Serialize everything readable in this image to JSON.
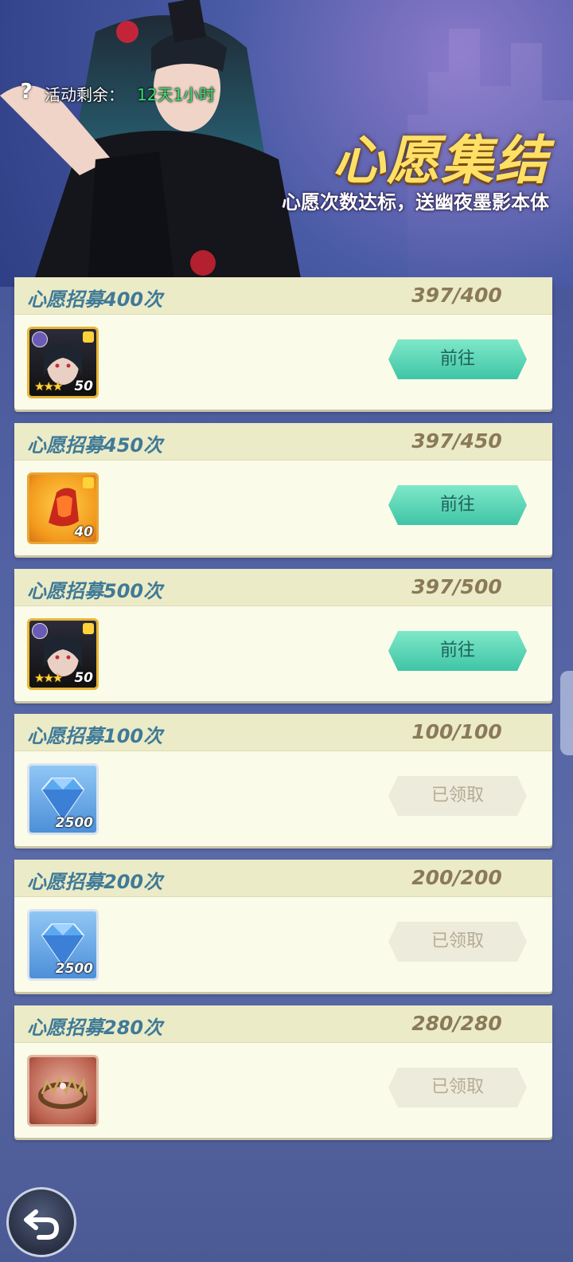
{
  "header": {
    "timer_label": "活动剩余：",
    "timer_value": "12天1小时",
    "title": "心愿集结",
    "subtitle": "心愿次数达标，送幽夜墨影本体"
  },
  "tasks": [
    {
      "title": "心愿招募400次",
      "progress": "397/400",
      "item_count": "50",
      "item_kind": "hero-shard",
      "button": "前往",
      "state": "go"
    },
    {
      "title": "心愿招募450次",
      "progress": "397/450",
      "item_count": "40",
      "item_kind": "red-artifact-shard",
      "button": "前往",
      "state": "go"
    },
    {
      "title": "心愿招募500次",
      "progress": "397/500",
      "item_count": "50",
      "item_kind": "hero-shard",
      "button": "前往",
      "state": "go"
    },
    {
      "title": "心愿招募100次",
      "progress": "100/100",
      "item_count": "2500",
      "item_kind": "diamond",
      "button": "已领取",
      "state": "claimed"
    },
    {
      "title": "心愿招募200次",
      "progress": "200/200",
      "item_count": "2500",
      "item_kind": "diamond",
      "button": "已领取",
      "state": "claimed"
    },
    {
      "title": "心愿招募280次",
      "progress": "280/280",
      "item_count": "",
      "item_kind": "thorn-crown",
      "button": "已领取",
      "state": "claimed"
    }
  ],
  "colors": {
    "go_button": "#4fd1b0",
    "claimed_button": "#ecebdc",
    "title_text": "#3f7a97",
    "timer_value": "#35e06e"
  }
}
